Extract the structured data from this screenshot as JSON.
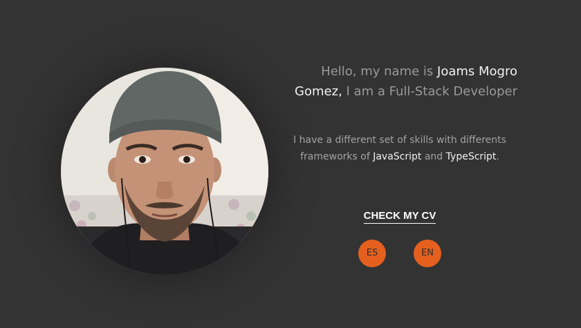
{
  "hero": {
    "intro": "Hello, my name is ",
    "name": "Joams Mogro Gomez,",
    "role": " I am a Full-Stack Developer"
  },
  "description": {
    "part1": "I have a different set of skills with differents frameworks of ",
    "js": "JavaScript",
    "part2": " and ",
    "ts": "TypeScript",
    "end": "."
  },
  "actions": {
    "cv_label": "CHECK MY CV",
    "lang_es": "ES",
    "lang_en": "EN"
  },
  "colors": {
    "background": "#333333",
    "accent": "#e5601f",
    "highlight": "#f2f2f2",
    "muted": "#9a9a9a"
  },
  "avatar": {
    "icon": "profile-photo"
  }
}
